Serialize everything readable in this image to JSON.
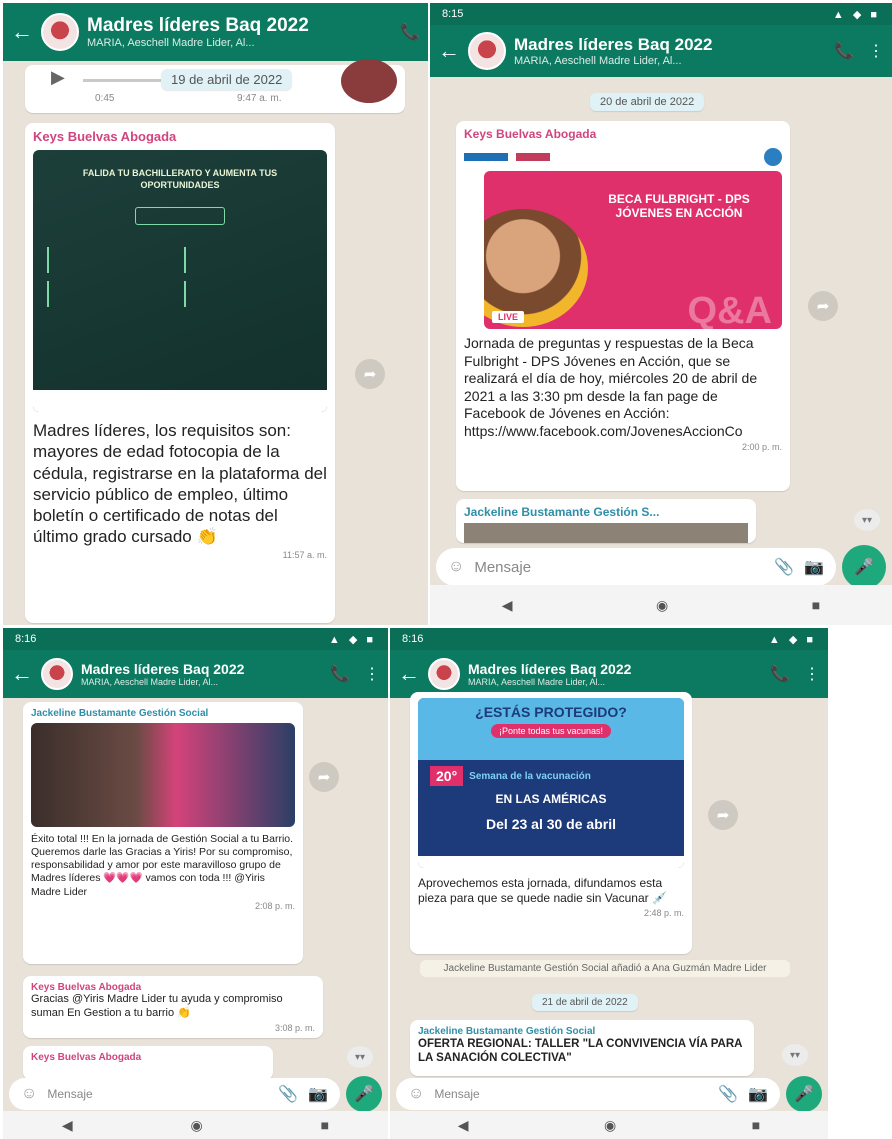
{
  "chat": {
    "title": "Madres líderes Baq 2022",
    "subtitle": "MARIA, Aeschell Madre Lider, Al...",
    "input_placeholder": "Mensaje"
  },
  "panels": [
    {
      "id": "p1",
      "voice_duration": "0:45",
      "voice_time": "9:47 a. m.",
      "date_chip": "19 de abril de 2022",
      "post": {
        "sender": "Keys Buelvas Abogada",
        "poster_heading": "FALIDA TU BACHILLERATO Y AUMENTA TUS OPORTUNIDADES",
        "text": "Madres líderes, los requisitos son: mayores de edad fotocopia de la cédula, registrarse en la plataforma del servicio público de empleo, último boletín o certificado de notas del último grado cursado 👏",
        "time": "11:57 a. m."
      }
    },
    {
      "id": "p2",
      "status_time": "8:15",
      "date_chip": "20 de abril de 2022",
      "post": {
        "sender": "Keys Buelvas Abogada",
        "poster_title": "BECA FULBRIGHT - DPS JÓVENES EN ACCIÓN",
        "poster_badge": "LIVE",
        "poster_big": "Q&A",
        "text": "Jornada de preguntas y respuestas de la Beca Fulbright - DPS Jóvenes en Acción, que se realizará el día de hoy, miércoles 20 de abril de 2021 a las 3:30 pm desde la fan page de Facebook de Jóvenes en Acción:",
        "link": "https://www.facebook.com/JovenesAccionCo",
        "time": "2:00 p. m."
      },
      "next_sender": "Jackeline Bustamante Gestión S..."
    },
    {
      "id": "p3",
      "status_time": "8:16",
      "post": {
        "sender": "Jackeline Bustamante Gestión Social",
        "text": "Éxito total !!! En la jornada de Gestión Social a tu Barrio. Queremos darle las Gracias a Yiris! Por su compromiso, responsabilidad y amor por este maravilloso grupo de Madres líderes 💗💗💗 vamos con toda !!! @Yiris Madre Lider",
        "time": "2:08 p. m."
      },
      "reply": {
        "sender": "Keys Buelvas Abogada",
        "text": "Gracias @Yiris Madre Lider tu ayuda y compromiso suman En Gestion a tu barrio 👏",
        "time": "3:08 p. m."
      },
      "next_sender": "Keys Buelvas Abogada"
    },
    {
      "id": "p4",
      "status_time": "8:16",
      "poster": {
        "headline": "¿ESTÁS PROTEGIDO?",
        "subline": "¡Ponte todas tus vacunas!",
        "number": "20°",
        "week": "Semana de la vacunación",
        "region": "EN LAS AMÉRICAS",
        "dates": "Del 23 al 30 de abril"
      },
      "post_text": "Aprovechemos esta jornada, difundamos esta pieza para que se quede nadie sin Vacunar 💉",
      "post_time": "2:48 p. m.",
      "system_msg": "Jackeline Bustamante Gestión Social añadió a Ana Guzmán Madre Lider",
      "date_chip": "21 de abril de 2022",
      "last_sender": "Jackeline Bustamante Gestión Social",
      "last_text": "OFERTA REGIONAL: TALLER \"LA CONVIVENCIA VÍA PARA LA SANACIÓN COLECTIVA\""
    }
  ],
  "colors": {
    "header": "#0b7a60",
    "chat_bg": "#e9e2d9",
    "accent_pink": "#d0457e",
    "accent_teal": "#2e8fa8",
    "mic": "#1da97c"
  }
}
